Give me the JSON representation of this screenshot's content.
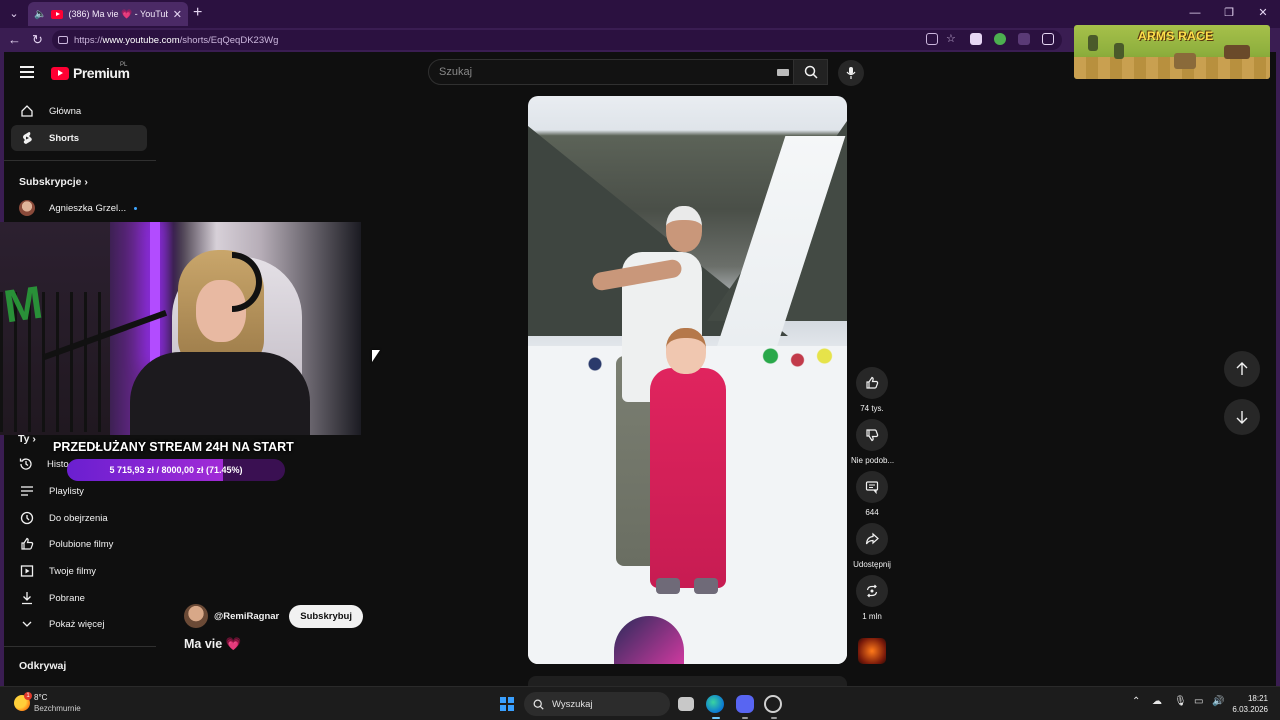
{
  "browser": {
    "tab_title": "(386) Ma vie 💗 - YouTube",
    "url_prefix": "https://",
    "url_host": "www.youtube.com",
    "url_path": "/shorts/EqQeqDK23Wg"
  },
  "header": {
    "logo_text": "Premium",
    "logo_region": "PL",
    "search_placeholder": "Szukaj"
  },
  "sidebar": {
    "items_top": [
      {
        "label": "Główna",
        "icon": "home-icon"
      },
      {
        "label": "Shorts",
        "icon": "shorts-icon"
      }
    ],
    "subscriptions_heading": "Subskrypcje",
    "subscriptions": [
      {
        "label": "Agnieszka Grzel..."
      }
    ],
    "you_heading": "Ty",
    "history_label": "Histo",
    "you_items": [
      {
        "label": "Playlisty",
        "icon": "playlist-icon"
      },
      {
        "label": "Do obejrzenia",
        "icon": "clock-icon"
      },
      {
        "label": "Polubione filmy",
        "icon": "thumbs-up-icon"
      },
      {
        "label": "Twoje filmy",
        "icon": "video-icon"
      },
      {
        "label": "Pobrane",
        "icon": "download-icon"
      },
      {
        "label": "Pokaż więcej",
        "icon": "chevron-down-icon"
      }
    ],
    "explore_heading": "Odkrywaj"
  },
  "stream_overlay": {
    "title": "PRZEDŁUŻANY STREAM 24H NA START",
    "progress_text": "5 715,93 zł  /  8000,00 zł  (71.45%)",
    "progress_fraction": 0.7145
  },
  "game_overlay": {
    "title": "ARMS RACE"
  },
  "short": {
    "channel": "@RemiRagnar",
    "subscribe_label": "Subskrybuj",
    "title": "Ma vie",
    "title_emoji": "💗"
  },
  "actions": [
    {
      "name": "like-button",
      "icon": "thumbs-up-icon",
      "label": "74 tys."
    },
    {
      "name": "dislike-button",
      "icon": "thumbs-down-icon",
      "label": "Nie podob..."
    },
    {
      "name": "comments-button",
      "icon": "comment-icon",
      "label": "644"
    },
    {
      "name": "share-button",
      "icon": "share-icon",
      "label": "Udostępnij"
    },
    {
      "name": "remix-button",
      "icon": "remix-icon",
      "label": "1 mln"
    }
  ],
  "taskbar": {
    "temperature": "8°C",
    "weather": "Bezchmurnie",
    "weather_badge": "1",
    "search_label": "Wyszukaj",
    "time": "18:21",
    "date": "6.03.2026"
  },
  "colors": {
    "browser_frame": "#3a1d52",
    "youtube_red": "#ff0033",
    "stream_bar": "#8a2be2"
  }
}
